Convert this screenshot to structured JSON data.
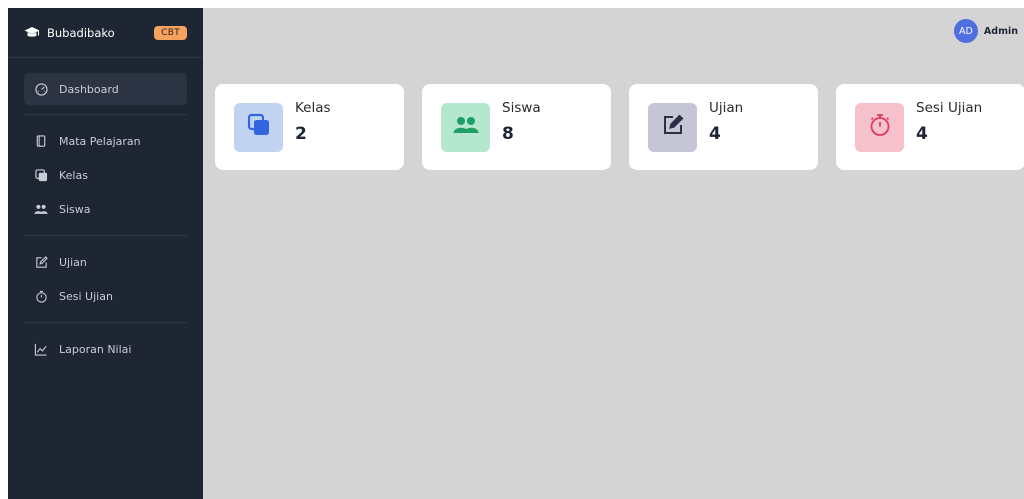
{
  "brand": {
    "name": "Bubadibako",
    "badge": "CBT",
    "icon": "graduation-cap-icon"
  },
  "sidebar": {
    "items": [
      {
        "label": "Dashboard",
        "icon": "speedometer-icon",
        "active": true
      },
      {
        "label": "Mata Pelajaran",
        "icon": "book-icon"
      },
      {
        "label": "Kelas",
        "icon": "copy-icon"
      },
      {
        "label": "Siswa",
        "icon": "people-icon"
      },
      {
        "label": "Ujian",
        "icon": "pencil-square-icon"
      },
      {
        "label": "Sesi Ujian",
        "icon": "stopwatch-icon"
      },
      {
        "label": "Laporan Nilai",
        "icon": "graph-up-icon"
      }
    ]
  },
  "user": {
    "initials": "AD",
    "name": "Admin"
  },
  "cards": [
    {
      "label": "Kelas",
      "value": "2",
      "icon": "copy-icon",
      "color": "#3465e0",
      "bg": "#c2d3f2"
    },
    {
      "label": "Siswa",
      "value": "8",
      "icon": "people-icon",
      "color": "#1f9e65",
      "bg": "#b5e6d0"
    },
    {
      "label": "Ujian",
      "value": "4",
      "icon": "pencil-square-icon",
      "color": "#2b2f45",
      "bg": "#c5c5d6"
    },
    {
      "label": "Sesi Ujian",
      "value": "4",
      "icon": "stopwatch-icon",
      "color": "#e03a5a",
      "bg": "#f6c1cd"
    }
  ],
  "colors": {
    "sidebar": "#1e2533",
    "main_bg": "#d4d4d4",
    "badge": "#f8a25e",
    "avatar": "#4f6fe0"
  }
}
